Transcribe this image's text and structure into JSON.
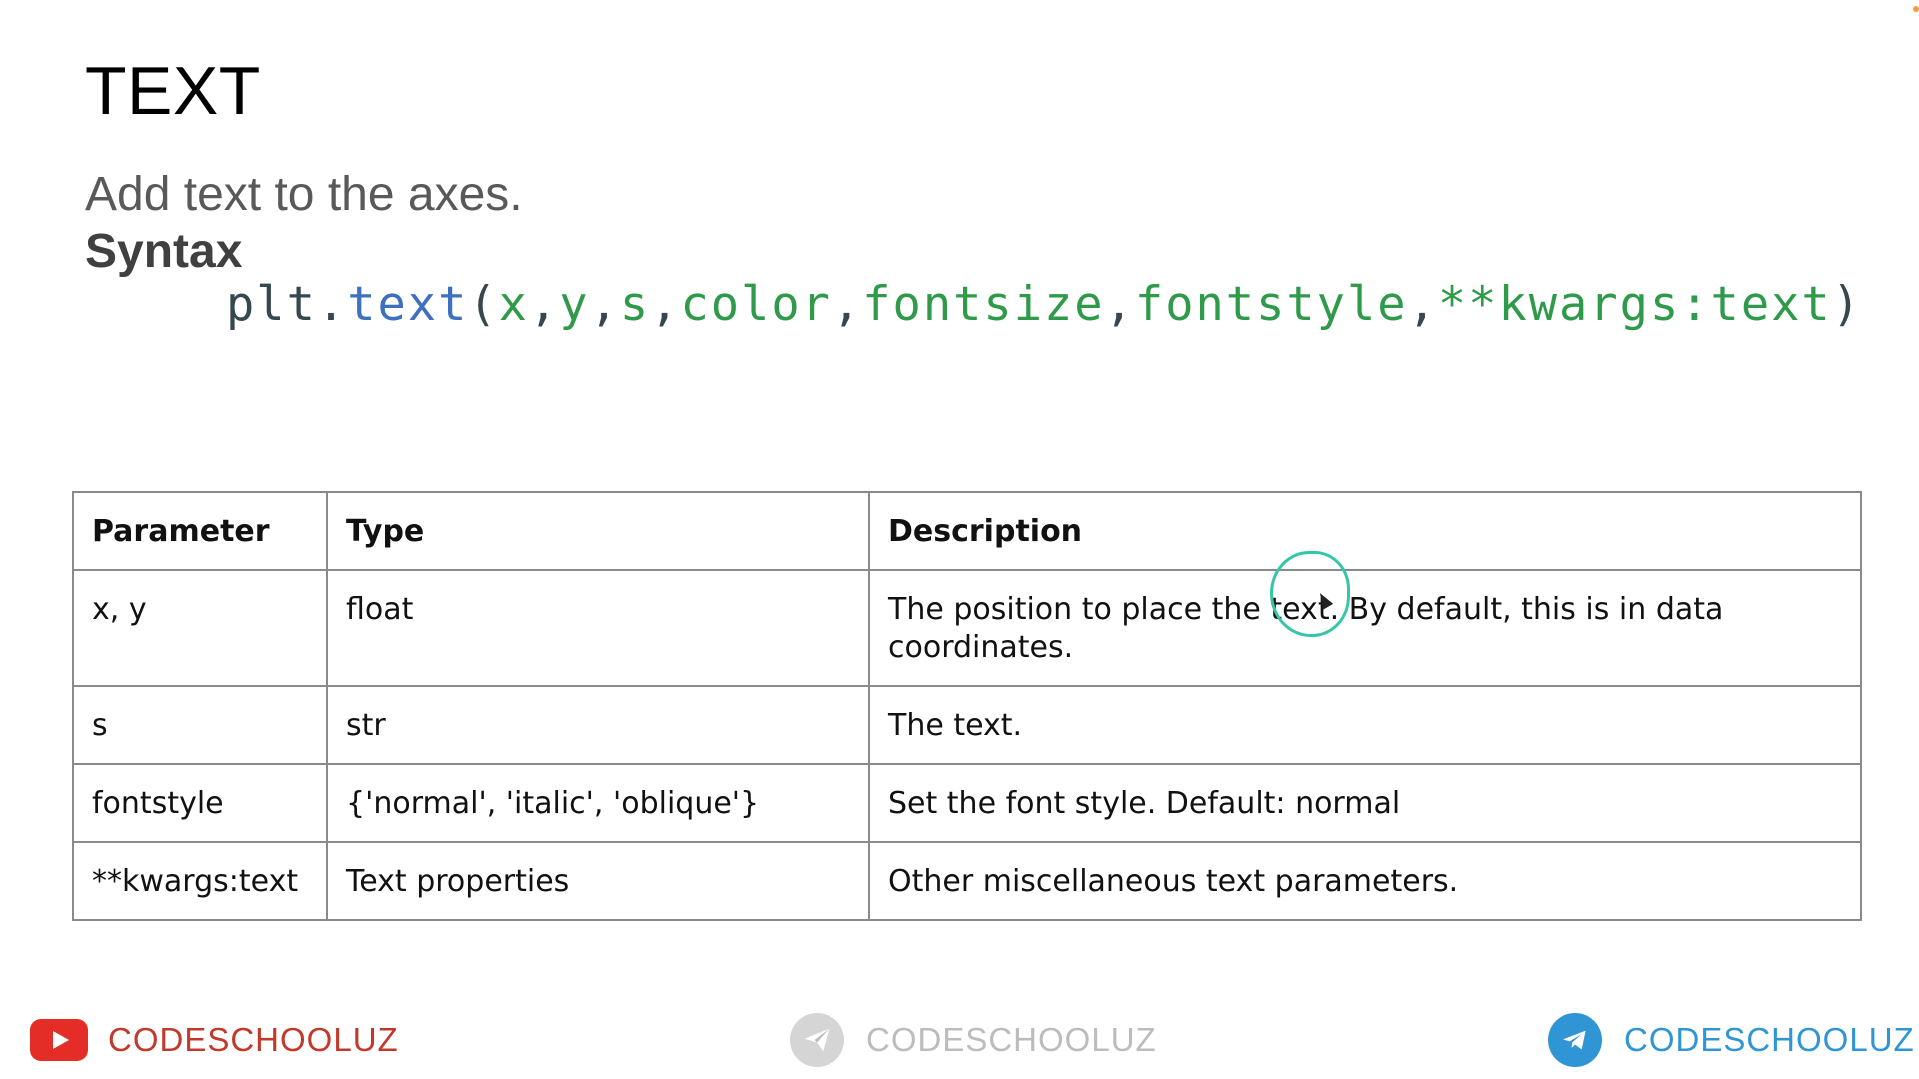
{
  "slide": {
    "title": "TEXT",
    "subtitle": "Add text to the axes.",
    "syntax_label": "Syntax"
  },
  "code": {
    "object": "plt",
    "dot": ".",
    "function": "text",
    "open_paren": "(",
    "close_paren": ")",
    "comma": ",",
    "args": [
      "x",
      "y",
      "s",
      "color",
      "fontsize",
      "fontstyle",
      "**kwargs:text"
    ]
  },
  "table": {
    "headers": [
      "Parameter",
      "Type",
      "Description"
    ],
    "rows": [
      [
        "x, y",
        "float",
        "The position to place the text. By default, this is in data coordinates."
      ],
      [
        "s",
        "str",
        "The text."
      ],
      [
        "fontstyle",
        "{'normal', 'italic', 'oblique'}",
        "Set the font style. Default: normal"
      ],
      [
        "**kwargs:text",
        "Text properties",
        "Other miscellaneous text parameters."
      ]
    ]
  },
  "footer": {
    "youtube_label": "CODESCHOOLUZ",
    "center_label": "CODESCHOOLUZ",
    "telegram_label": "CODESCHOOLUZ"
  },
  "colors": {
    "code_dark": "#37474f",
    "code_function": "#3f6fbf",
    "code_param": "#2e9a4a",
    "youtube_red": "#e52d27",
    "telegram_blue": "#2f95d4",
    "annotation": "#35c6a8"
  }
}
